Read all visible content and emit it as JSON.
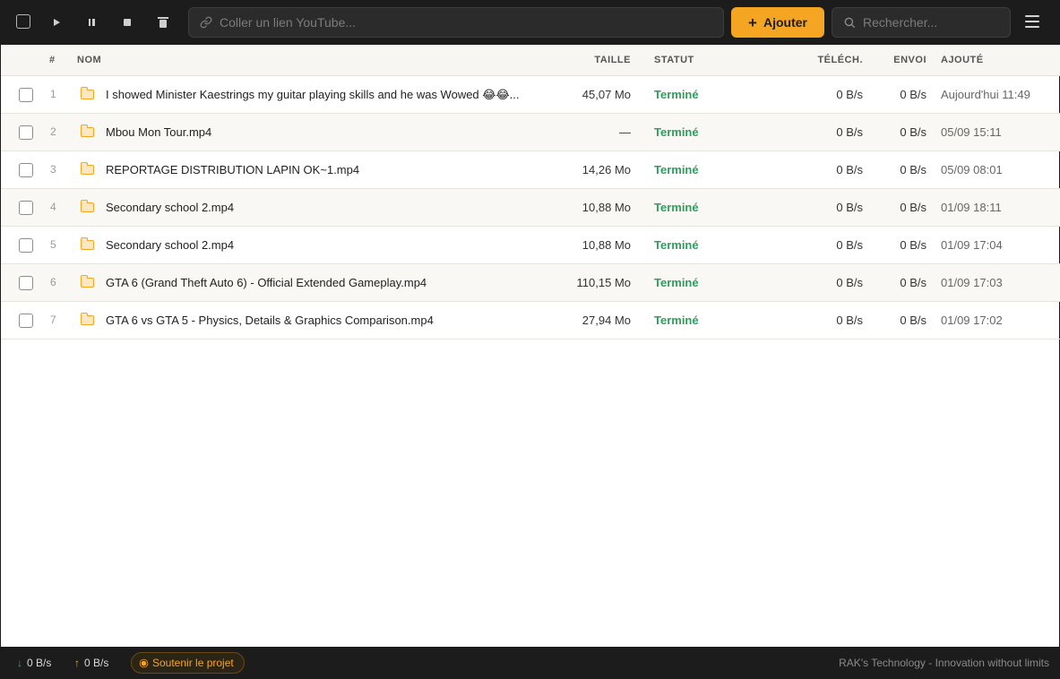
{
  "toolbar": {
    "link_placeholder": "Coller un lien YouTube...",
    "add_label": "Ajouter",
    "search_placeholder": "Rechercher...",
    "accent_color": "#f4a623"
  },
  "table": {
    "columns": {
      "num": "#",
      "name": "NOM",
      "size": "TAILLE",
      "status": "STATUT",
      "download": "TÉLÉCH.",
      "upload": "ENVOI",
      "added": "AJOUTÉ"
    },
    "rows": [
      {
        "num": "1",
        "name": "I showed Minister Kaestrings my guitar playing skills and he was Wowed 😂😂...",
        "size": "45,07 Mo",
        "status": "Terminé",
        "download": "0 B/s",
        "upload": "0 B/s",
        "added": "Aujourd'hui 11:49"
      },
      {
        "num": "2",
        "name": "Mbou Mon Tour.mp4",
        "size": "—",
        "status": "Terminé",
        "download": "0 B/s",
        "upload": "0 B/s",
        "added": "05/09 15:11"
      },
      {
        "num": "3",
        "name": "REPORTAGE DISTRIBUTION LAPIN OK~1.mp4",
        "size": "14,26 Mo",
        "status": "Terminé",
        "download": "0 B/s",
        "upload": "0 B/s",
        "added": "05/09 08:01"
      },
      {
        "num": "4",
        "name": "Secondary school 2.mp4",
        "size": "10,88 Mo",
        "status": "Terminé",
        "download": "0 B/s",
        "upload": "0 B/s",
        "added": "01/09 18:11"
      },
      {
        "num": "5",
        "name": "Secondary school 2.mp4",
        "size": "10,88 Mo",
        "status": "Terminé",
        "download": "0 B/s",
        "upload": "0 B/s",
        "added": "01/09 17:04"
      },
      {
        "num": "6",
        "name": "GTA 6 (Grand Theft Auto 6) - Official Extended Gameplay.mp4",
        "size": "110,15 Mo",
        "status": "Terminé",
        "download": "0 B/s",
        "upload": "0 B/s",
        "added": "01/09 17:03"
      },
      {
        "num": "7",
        "name": "GTA 6 vs GTA 5 - Physics, Details & Graphics Comparison.mp4",
        "size": "27,94 Mo",
        "status": "Terminé",
        "download": "0 B/s",
        "upload": "0 B/s",
        "added": "01/09 17:02"
      }
    ]
  },
  "footer": {
    "download_speed": "0 B/s",
    "upload_speed": "0 B/s",
    "support_label": "Soutenir le projet",
    "brand": "RAK's Technology - Innovation without limits"
  },
  "icons": {
    "select_all": "checkbox-icon",
    "start": "play-icon",
    "pause": "pause-icon",
    "stop": "stop-icon",
    "delete": "trash-icon",
    "link": "link-icon",
    "search": "search-icon",
    "menu": "hamburger-menu-icon",
    "folder": "folder-icon"
  }
}
